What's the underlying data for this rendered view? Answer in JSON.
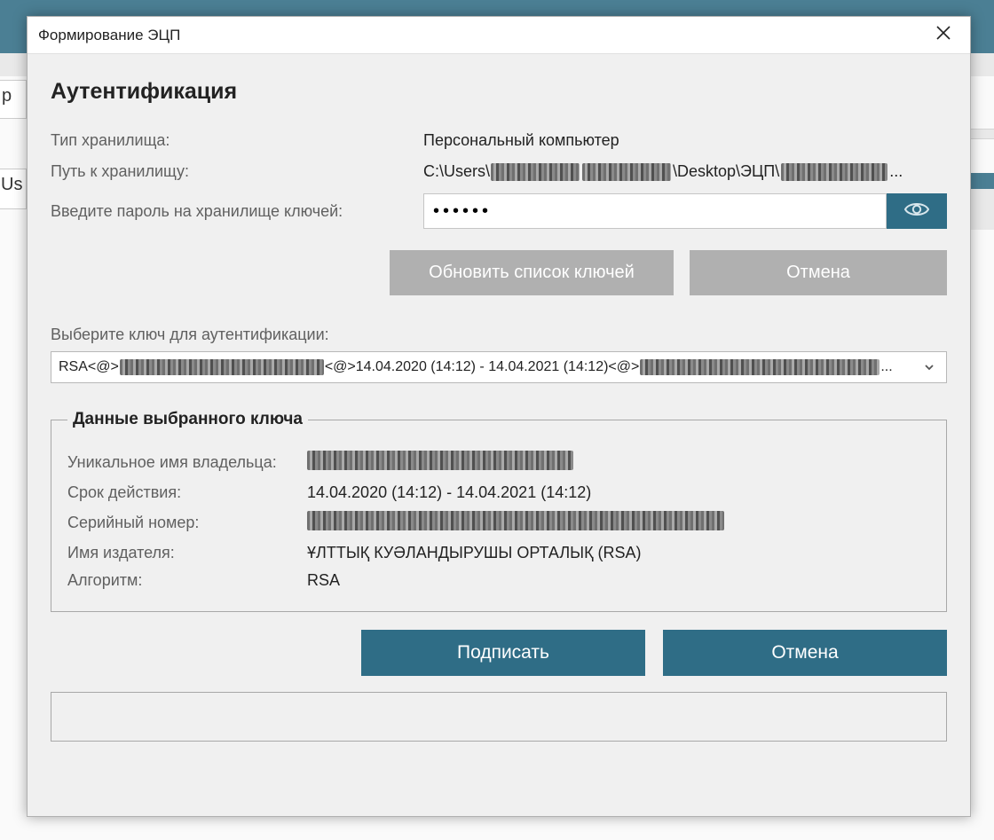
{
  "bg": {
    "partial_input_1": "р",
    "partial_input_2": "Us"
  },
  "dialog": {
    "title": "Формирование ЭЦП",
    "heading": "Аутентификация",
    "storage_type_label": "Тип хранилища:",
    "storage_type_value": "Персональный компьютер",
    "storage_path_label": "Путь к хранилищу:",
    "storage_path_parts": {
      "p1": "C:\\Users\\",
      "p2": "\\Desktop\\ЭЦП\\",
      "trail": "..."
    },
    "password_label": "Введите пароль на хранилище ключей:",
    "password_value": "••••••",
    "refresh_btn": "Обновить список ключей",
    "cancel_btn_1": "Отмена",
    "select_key_label": "Выберите ключ для аутентификации:",
    "select_value": {
      "p1": "RSA<@>",
      "p2": "<@>14.04.2020 (14:12) - 14.04.2021 (14:12)<@>",
      "trail": "..."
    },
    "key_data_legend": "Данные выбранного ключа",
    "owner_label": "Уникальное имя владельца:",
    "validity_label": "Срок действия:",
    "validity_value": "14.04.2020 (14:12) - 14.04.2021 (14:12)",
    "serial_label": "Серийный номер:",
    "issuer_label": "Имя издателя:",
    "issuer_value": "ҰЛТТЫҚ КУӘЛАНДЫРУШЫ ОРТАЛЫҚ (RSA)",
    "algorithm_label": "Алгоритм:",
    "algorithm_value": "RSA",
    "sign_btn": "Подписать",
    "cancel_btn_2": "Отмена"
  }
}
